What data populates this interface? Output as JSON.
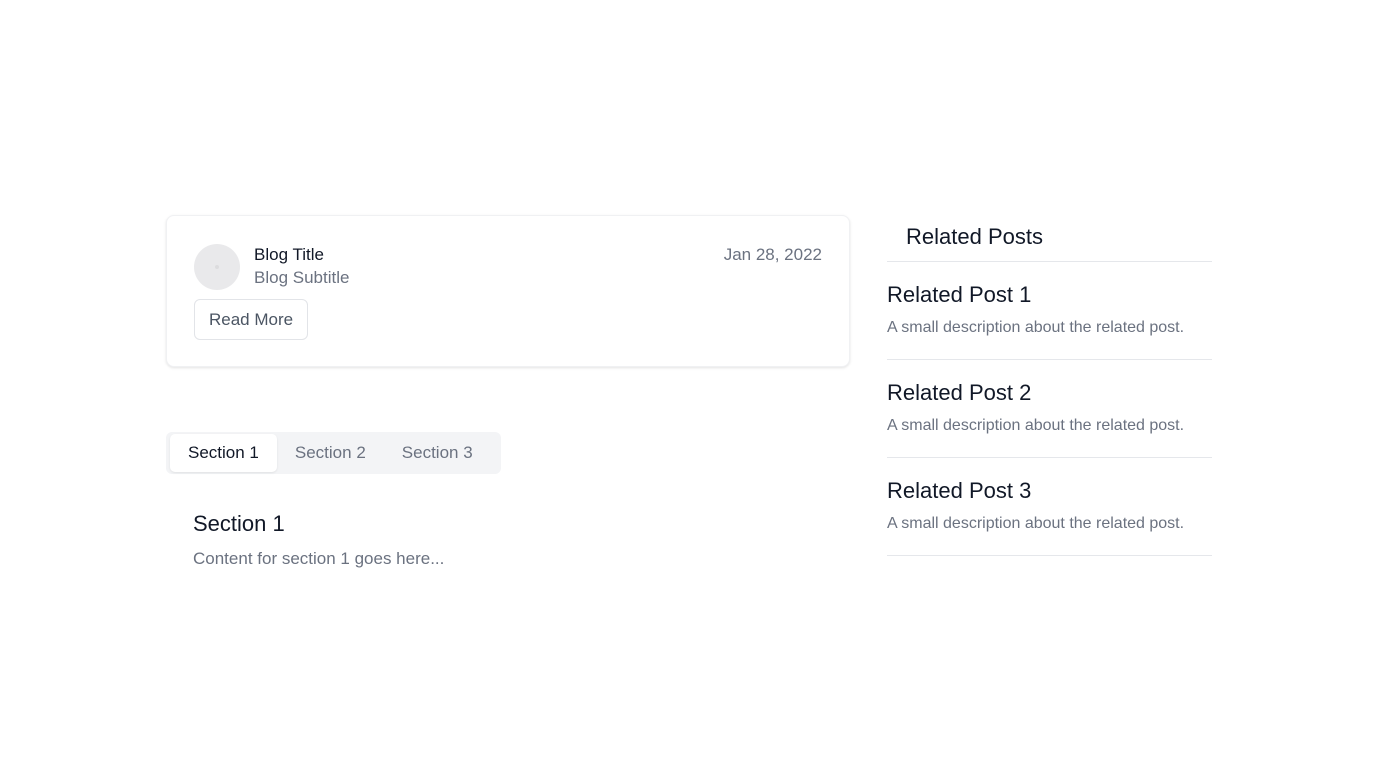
{
  "blog_card": {
    "title": "Blog Title",
    "subtitle": "Blog Subtitle",
    "date": "Jan 28, 2022",
    "read_more_label": "Read More"
  },
  "tabs": [
    {
      "label": "Section 1",
      "active": true
    },
    {
      "label": "Section 2",
      "active": false
    },
    {
      "label": "Section 3",
      "active": false
    }
  ],
  "active_section": {
    "heading": "Section 1",
    "content": "Content for section 1 goes here..."
  },
  "related_posts": {
    "header": "Related Posts",
    "items": [
      {
        "title": "Related Post 1",
        "description": "A small description about the related post."
      },
      {
        "title": "Related Post 2",
        "description": "A small description about the related post."
      },
      {
        "title": "Related Post 3",
        "description": "A small description about the related post."
      }
    ]
  }
}
